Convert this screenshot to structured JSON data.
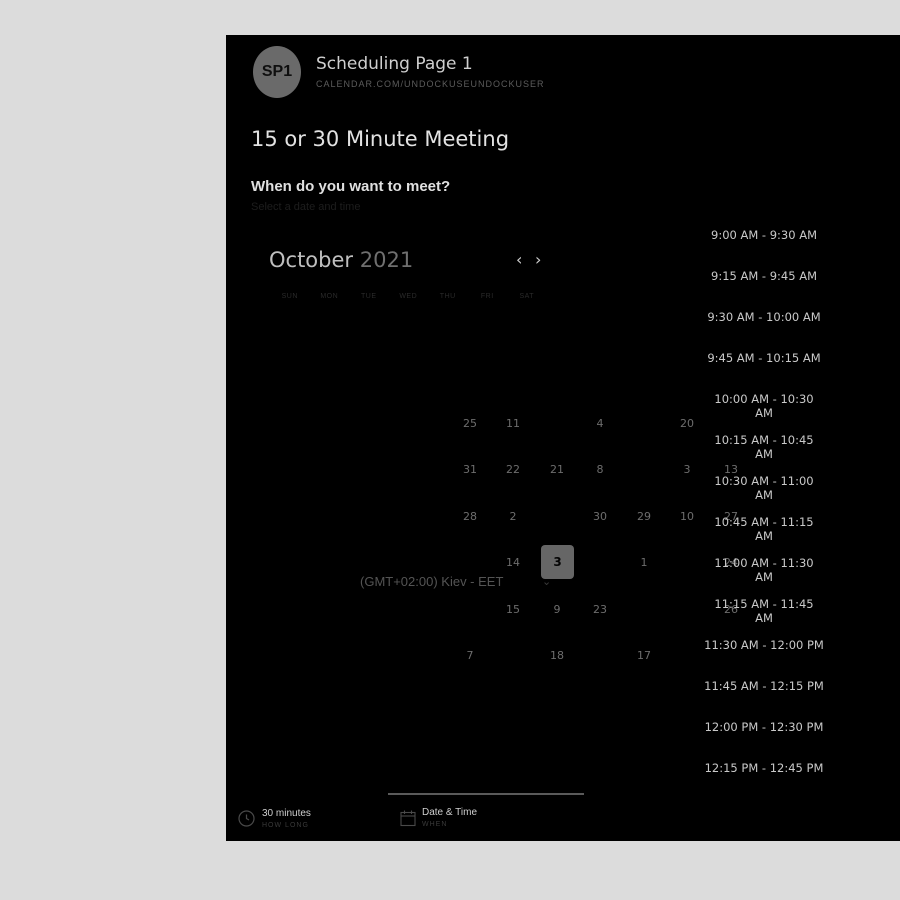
{
  "header": {
    "avatar_initials": "SP1",
    "page_name": "Scheduling Page 1",
    "page_url": "CALENDAR.COM/UNDOCKUSEUNDOCKUSER"
  },
  "meeting": {
    "title": "15 or 30 Minute Meeting",
    "question": "When do you want to meet?",
    "hint": "Select a date and time"
  },
  "calendar": {
    "month": "October",
    "year": "2021",
    "prev_icon": "chevron-left-icon",
    "next_icon": "chevron-right-icon",
    "weekdays": [
      "SUN",
      "MON",
      "TUE",
      "WED",
      "THU",
      "FRI",
      "SAT"
    ],
    "days": [
      "25",
      "11",
      "4",
      "20",
      "31",
      "22",
      "21",
      "8",
      "3",
      "13",
      "28",
      "2",
      "30",
      "29",
      "10",
      "27",
      "14",
      "3",
      "1",
      "24",
      "15",
      "9",
      "23",
      "26",
      "7",
      "18",
      "17"
    ],
    "selected_day": "3"
  },
  "timezone": {
    "label": "(GMT+02:00) Kiev - EET",
    "chevron_icon": "chevron-down-icon"
  },
  "time_slots": [
    "9:00 AM - 9:30 AM",
    "9:15 AM - 9:45 AM",
    "9:30 AM - 10:00 AM",
    "9:45 AM - 10:15 AM",
    "10:00 AM - 10:30 AM",
    "10:15 AM - 10:45 AM",
    "10:30 AM - 11:00 AM",
    "10:45 AM - 11:15 AM",
    "11:00 AM - 11:30 AM",
    "11:15 AM - 11:45 AM",
    "11:30 AM - 12:00 PM",
    "11:45 AM - 12:15 PM",
    "12:00 PM - 12:30 PM",
    "12:15 PM - 12:45 PM"
  ],
  "footer": {
    "duration_label": "30 minutes",
    "duration_sub": "HOW LONG",
    "duration_icon": "clock-icon",
    "datetime_label": "Date & Time",
    "datetime_sub": "WHEN",
    "datetime_icon": "calendar-icon"
  }
}
